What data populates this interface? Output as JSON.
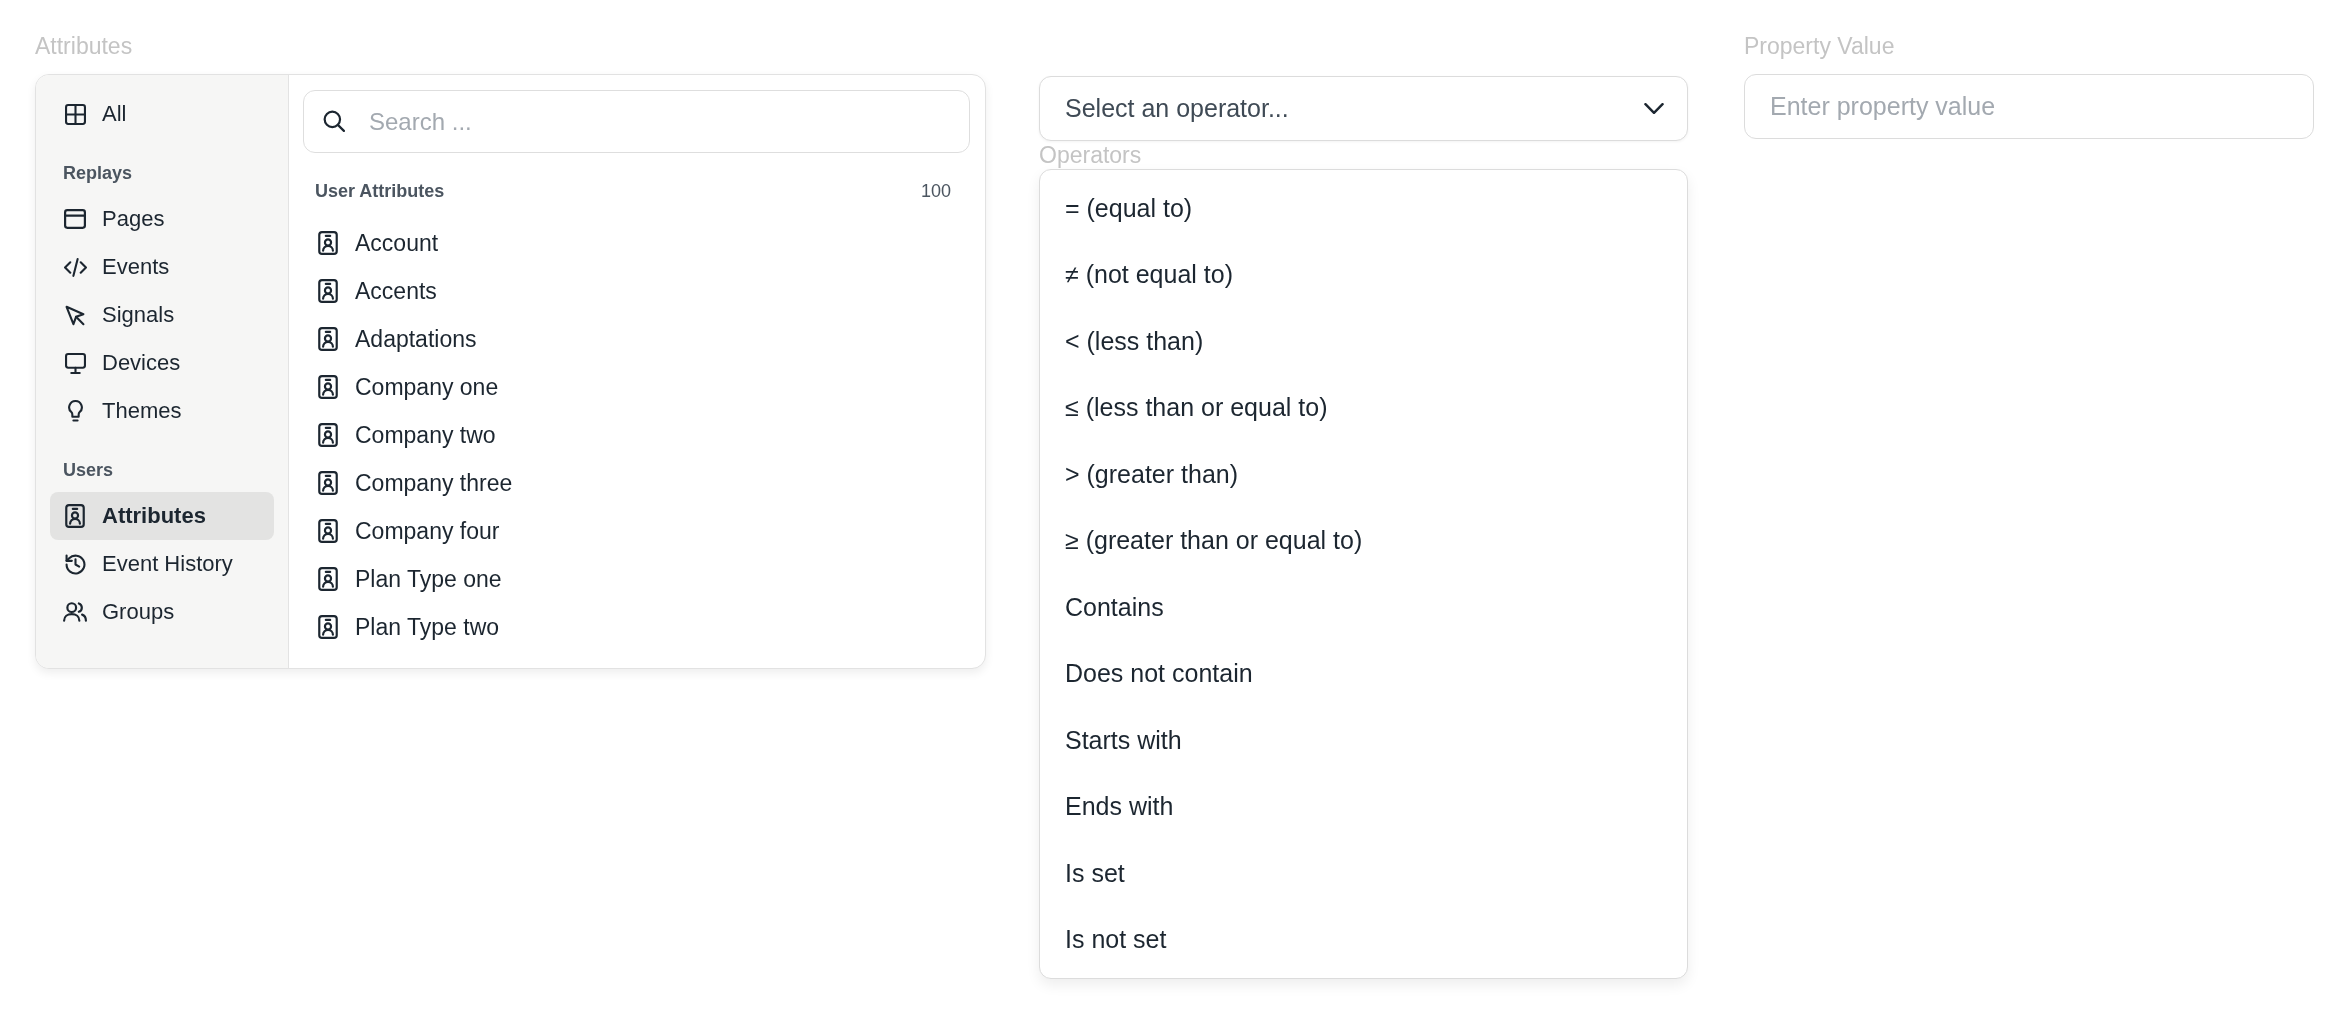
{
  "attributes": {
    "label": "Attributes",
    "sidebar": {
      "items": [
        {
          "label": "All",
          "selected": false
        }
      ],
      "sections": [
        {
          "heading": "Replays",
          "items": [
            {
              "label": "Pages",
              "selected": false
            },
            {
              "label": "Events",
              "selected": false
            },
            {
              "label": "Signals",
              "selected": false
            },
            {
              "label": "Devices",
              "selected": false
            },
            {
              "label": "Themes",
              "selected": false
            }
          ]
        },
        {
          "heading": "Users",
          "items": [
            {
              "label": "Attributes",
              "selected": true
            },
            {
              "label": "Event History",
              "selected": false
            },
            {
              "label": "Groups",
              "selected": false
            }
          ]
        }
      ]
    },
    "search": {
      "placeholder": "Search ..."
    },
    "list": {
      "heading": "User Attributes",
      "count": "100",
      "items": [
        {
          "label": "Account",
          "selected": false
        },
        {
          "label": "Accents",
          "selected": false
        },
        {
          "label": "Adaptations",
          "selected": false
        },
        {
          "label": "Company one",
          "selected": false
        },
        {
          "label": "Company two",
          "selected": false
        },
        {
          "label": "Company three",
          "selected": false
        },
        {
          "label": "Company four",
          "selected": false
        },
        {
          "label": "Plan Type one",
          "selected": false
        },
        {
          "label": "Plan Type two",
          "selected": false
        }
      ]
    }
  },
  "operator": {
    "placeholder": "Select an operator...",
    "options_label": "Operators",
    "options": [
      {
        "label": "= (equal to)",
        "selected": false
      },
      {
        "label": "≠ (not equal to)",
        "selected": false
      },
      {
        "label": "< (less than)",
        "selected": false
      },
      {
        "label": "≤ (less than or equal to)",
        "selected": false
      },
      {
        "label": "> (greater than)",
        "selected": false
      },
      {
        "label": "≥ (greater than or equal to)",
        "selected": false
      },
      {
        "label": "Contains",
        "selected": false
      },
      {
        "label": "Does not contain",
        "selected": false
      },
      {
        "label": "Starts with",
        "selected": false
      },
      {
        "label": "Ends with",
        "selected": false
      },
      {
        "label": "Is set",
        "selected": false
      },
      {
        "label": "Is not set",
        "selected": false
      }
    ]
  },
  "property_value": {
    "label": "Property Value",
    "placeholder": "Enter property value"
  }
}
